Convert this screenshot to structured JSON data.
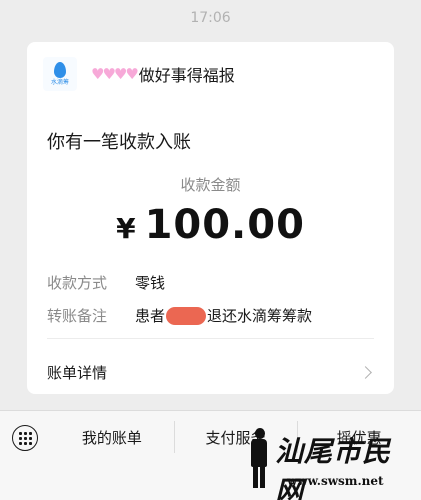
{
  "status": {
    "time": "17:06"
  },
  "message": {
    "sender": {
      "logo_icon": "water-drop-logo-icon",
      "logo_text": "水滴筹",
      "name_decoration": "♥♥♥♥",
      "name": "做好事得福报"
    },
    "title": "你有一笔收款入账",
    "amount_label": "收款金额",
    "currency": "¥",
    "amount": "100.00",
    "fields": [
      {
        "label": "收款方式",
        "value": "零钱"
      },
      {
        "label": "转账备注",
        "value_prefix": "患者",
        "value_suffix": "退还水滴筹筹款"
      }
    ],
    "details_label": "账单详情",
    "chevron_icon": "chevron-right-icon"
  },
  "bottom_menu": {
    "keyboard_icon": "keyboard-icon",
    "items": [
      "我的账单",
      "支付服务",
      "摇优惠"
    ]
  },
  "watermark": {
    "title": "汕尾市民网",
    "url": "www.swsm.net"
  },
  "colors": {
    "background": "#ededed",
    "card": "#ffffff",
    "redaction": "#e9573f",
    "logo_accent": "#2f8fe8"
  }
}
